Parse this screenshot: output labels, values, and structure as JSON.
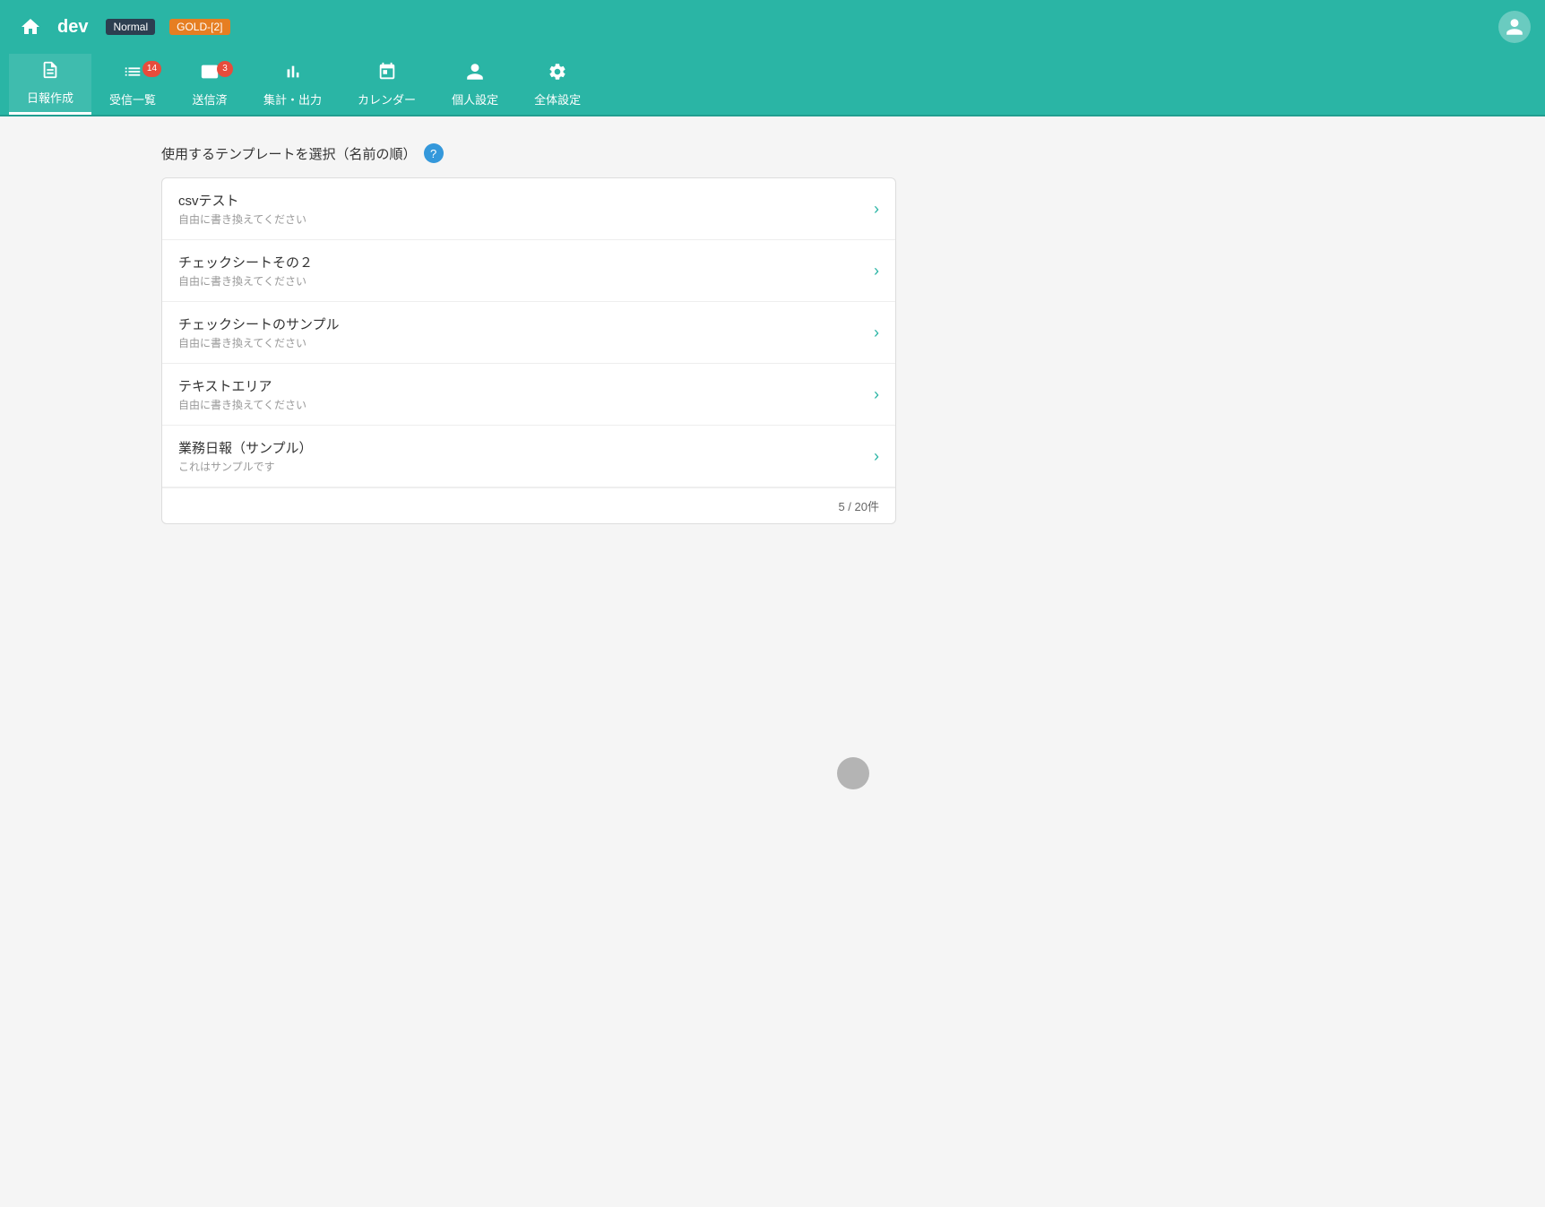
{
  "header": {
    "app_name": "dev",
    "badge_normal": "Normal",
    "badge_gold": "GOLD-[2]"
  },
  "nav": {
    "items": [
      {
        "id": "create",
        "label": "日報作成",
        "badge": null,
        "active": true
      },
      {
        "id": "inbox",
        "label": "受信一覧",
        "badge": "14",
        "active": false
      },
      {
        "id": "sent",
        "label": "送信済",
        "badge": "3",
        "active": false
      },
      {
        "id": "report",
        "label": "集計・出力",
        "badge": null,
        "active": false
      },
      {
        "id": "calendar",
        "label": "カレンダー",
        "badge": null,
        "active": false
      },
      {
        "id": "personal",
        "label": "個人設定",
        "badge": null,
        "active": false
      },
      {
        "id": "settings",
        "label": "全体設定",
        "badge": null,
        "active": false
      }
    ]
  },
  "main": {
    "page_title": "使用するテンプレートを選択（名前の順）",
    "templates": [
      {
        "name": "csvテスト",
        "desc": "自由に書き換えてください"
      },
      {
        "name": "チェックシートその２",
        "desc": "自由に書き換えてください"
      },
      {
        "name": "チェックシートのサンプル",
        "desc": "自由に書き換えてください"
      },
      {
        "name": "テキストエリア",
        "desc": "自由に書き換えてください"
      },
      {
        "name": "業務日報（サンプル）",
        "desc": "これはサンプルです"
      }
    ],
    "pagination": "5 / 20件"
  }
}
